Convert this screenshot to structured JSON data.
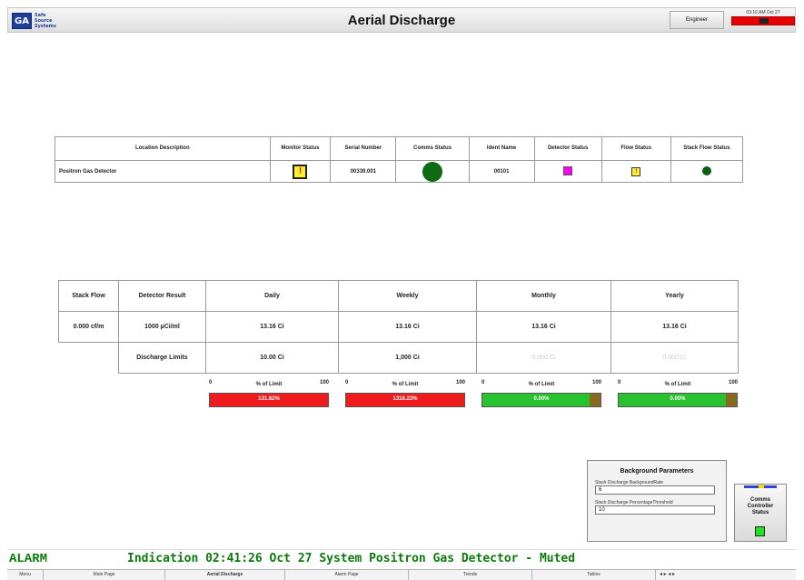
{
  "header": {
    "title": "Aerial Discharge",
    "logo_mark": "GA",
    "logo_text": [
      "Safe",
      "Source",
      "Systems"
    ],
    "user_label": "Engineer",
    "clock": "03:10 AM Oct 27",
    "alarm_color": "#e60000"
  },
  "status_table": {
    "headers": [
      "Location Description",
      "Monitor Status",
      "Serial Number",
      "Comms Status",
      "Ident Name",
      "Detector Status",
      "Flow Status",
      "Stack Flow Status"
    ],
    "row": {
      "location": "Positron Gas Detector",
      "monitor_icon": "!",
      "serial": "00339.001",
      "ident": "00101"
    }
  },
  "results_table": {
    "stack_flow_label": "Stack Flow",
    "stack_flow_value": "0.000 cf/m",
    "detector_result_label": "Detector Result",
    "detector_result_value": "1000 µCi/ml",
    "discharge_limits_label": "Discharge Limits",
    "periods": [
      {
        "name": "Daily",
        "result": "13.16 Ci",
        "limit": "10.00 Ci"
      },
      {
        "name": "Weekly",
        "result": "13.16 Ci",
        "limit": "1,000 Ci"
      },
      {
        "name": "Monthly",
        "result": "13.16 Ci",
        "limit": "0.000 Ci"
      },
      {
        "name": "Yearly",
        "result": "13.16 Ci",
        "limit": "0.000 Ci"
      }
    ]
  },
  "limit_bars": [
    {
      "min": "0",
      "label": "% of Limit",
      "max": "100",
      "value": "131.62%",
      "status": "over",
      "fill_pct": 100
    },
    {
      "min": "0",
      "label": "% of Limit",
      "max": "100",
      "value": "1316.22%",
      "status": "over",
      "fill_pct": 100
    },
    {
      "min": "0",
      "label": "% of Limit",
      "max": "100",
      "value": "0.00%",
      "status": "ok",
      "fill_pct": 0
    },
    {
      "min": "0",
      "label": "% of Limit",
      "max": "100",
      "value": "0.00%",
      "status": "ok",
      "fill_pct": 0
    }
  ],
  "background_params": {
    "title": "Background Parameters",
    "rate_label": "Stack Discharge  BackgroundRate",
    "rate_value": "6",
    "threshold_label": "Stack Discharge  PercentageThreshold",
    "threshold_value": "10"
  },
  "comms_controller": {
    "label_line1": "Comms",
    "label_line2": "Controller",
    "label_line3": "Status",
    "status_color": "#22e022"
  },
  "alarm_bar": {
    "word": "ALARM",
    "message": "Indication 02:41:26 Oct 27 System  Positron Gas Detector - Muted",
    "color": "#0a7a0a"
  },
  "nav": {
    "items": [
      "Menu",
      "Main Page",
      "Aerial Discharge",
      "Alarm Page",
      "Trends",
      "Tables"
    ],
    "active": "Aerial Discharge",
    "arrows": "◂ ▸ ◂ ▸"
  }
}
